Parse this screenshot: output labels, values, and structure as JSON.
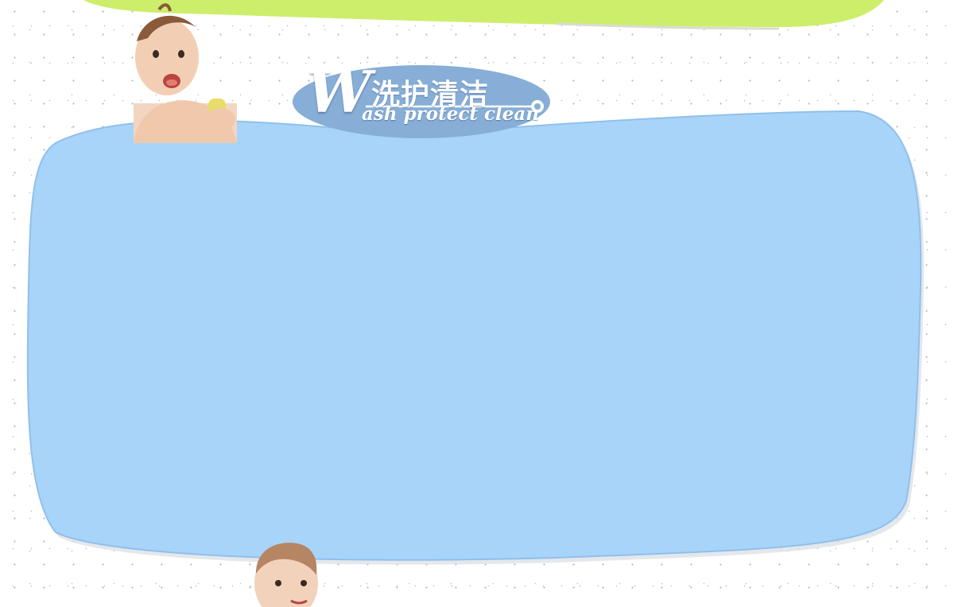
{
  "badge": {
    "initial": "W",
    "title": "洗护清洁",
    "subtitle": "ash protect clean"
  },
  "colors": {
    "top_band": "#cdee6b",
    "panel_fill": "#a8d4f9",
    "panel_border": "#8fc0ec",
    "badge_fill": "#86aed6"
  },
  "icons": {
    "baby_top": "baby-bath-photo",
    "baby_bottom": "baby-smiling-photo"
  }
}
